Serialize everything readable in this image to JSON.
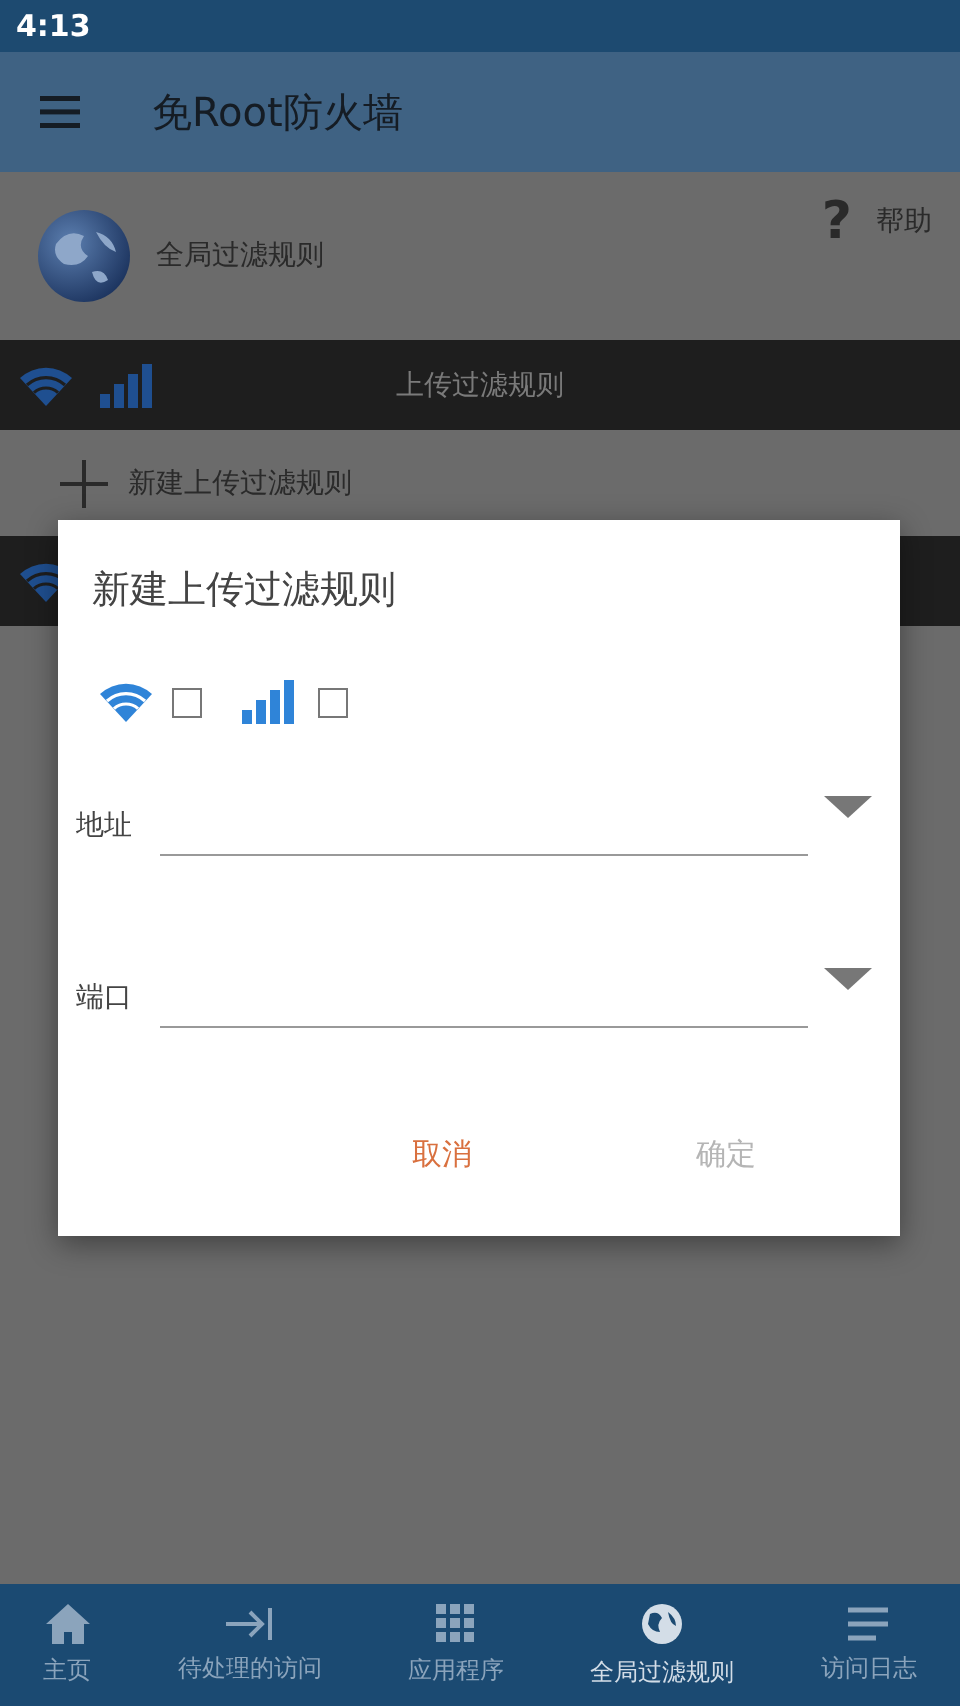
{
  "status_bar": {
    "time": "4:13"
  },
  "app_bar": {
    "title": "免Root防火墙"
  },
  "global_rules": {
    "label": "全局过滤规则"
  },
  "help": {
    "icon": "?",
    "label": "帮助"
  },
  "upload_section": {
    "title": "上传过滤规则"
  },
  "new_rule": {
    "label": "新建上传过滤规则"
  },
  "dialog": {
    "title": "新建上传过滤规则",
    "networks": [
      {
        "kind": "wifi",
        "checked": false
      },
      {
        "kind": "mobile",
        "checked": false
      }
    ],
    "fields": [
      {
        "label": "地址"
      },
      {
        "label": "端口"
      }
    ],
    "buttons": [
      {
        "label": "取消",
        "disabled": false
      },
      {
        "label": "确定",
        "disabled": true
      }
    ]
  },
  "bottom_nav": [
    {
      "kind": "home",
      "label": "主页",
      "selected": false
    },
    {
      "kind": "pending",
      "label": "待处理的访问",
      "selected": false
    },
    {
      "kind": "apps",
      "label": "应用程序",
      "selected": false
    },
    {
      "kind": "globe",
      "label": "全局过滤规则",
      "selected": true
    },
    {
      "kind": "log",
      "label": "访问日志",
      "selected": false
    }
  ]
}
